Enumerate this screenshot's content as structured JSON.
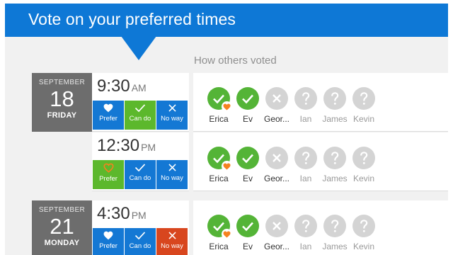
{
  "header": {
    "title": "Vote on your preferred times"
  },
  "others_heading": "How others voted",
  "colors": {
    "accent": "#0e78d6",
    "can_do": "#5cb82c",
    "no_way_selected": "#d8461e",
    "prefer_heart": "#f5821f"
  },
  "dates": [
    {
      "month": "SEPTEMBER",
      "day": "18",
      "weekday": "FRIDAY"
    },
    {
      "month": "SEPTEMBER",
      "day": "21",
      "weekday": "MONDAY"
    }
  ],
  "slots": [
    {
      "time": "9:30",
      "ampm": "AM",
      "selected": "can_do",
      "options": [
        {
          "label": "Prefer",
          "icon": "heart-icon"
        },
        {
          "label": "Can do",
          "icon": "check-icon"
        },
        {
          "label": "No way",
          "icon": "x-icon"
        }
      ],
      "voters": [
        {
          "name": "Erica",
          "vote": "can_do",
          "prefer": true
        },
        {
          "name": "Ev",
          "vote": "can_do",
          "prefer": false
        },
        {
          "name": "Geor...",
          "vote": "no_way",
          "prefer": false
        },
        {
          "name": "Ian",
          "vote": "unknown",
          "prefer": false
        },
        {
          "name": "James",
          "vote": "unknown",
          "prefer": false
        },
        {
          "name": "Kevin",
          "vote": "unknown",
          "prefer": false
        }
      ]
    },
    {
      "time": "12:30",
      "ampm": "PM",
      "selected": "prefer",
      "options": [
        {
          "label": "Prefer",
          "icon": "heart-icon"
        },
        {
          "label": "Can do",
          "icon": "check-icon"
        },
        {
          "label": "No way",
          "icon": "x-icon"
        }
      ],
      "voters": [
        {
          "name": "Erica",
          "vote": "can_do",
          "prefer": true
        },
        {
          "name": "Ev",
          "vote": "can_do",
          "prefer": false
        },
        {
          "name": "Geor...",
          "vote": "no_way",
          "prefer": false
        },
        {
          "name": "Ian",
          "vote": "unknown",
          "prefer": false
        },
        {
          "name": "James",
          "vote": "unknown",
          "prefer": false
        },
        {
          "name": "Kevin",
          "vote": "unknown",
          "prefer": false
        }
      ]
    },
    {
      "time": "4:30",
      "ampm": "PM",
      "selected": "no_way",
      "options": [
        {
          "label": "Prefer",
          "icon": "heart-icon"
        },
        {
          "label": "Can do",
          "icon": "check-icon"
        },
        {
          "label": "No way",
          "icon": "x-icon"
        }
      ],
      "voters": [
        {
          "name": "Erica",
          "vote": "can_do",
          "prefer": true
        },
        {
          "name": "Ev",
          "vote": "can_do",
          "prefer": false
        },
        {
          "name": "Geor...",
          "vote": "no_way",
          "prefer": false
        },
        {
          "name": "Ian",
          "vote": "unknown",
          "prefer": false
        },
        {
          "name": "James",
          "vote": "unknown",
          "prefer": false
        },
        {
          "name": "Kevin",
          "vote": "unknown",
          "prefer": false
        }
      ]
    }
  ]
}
